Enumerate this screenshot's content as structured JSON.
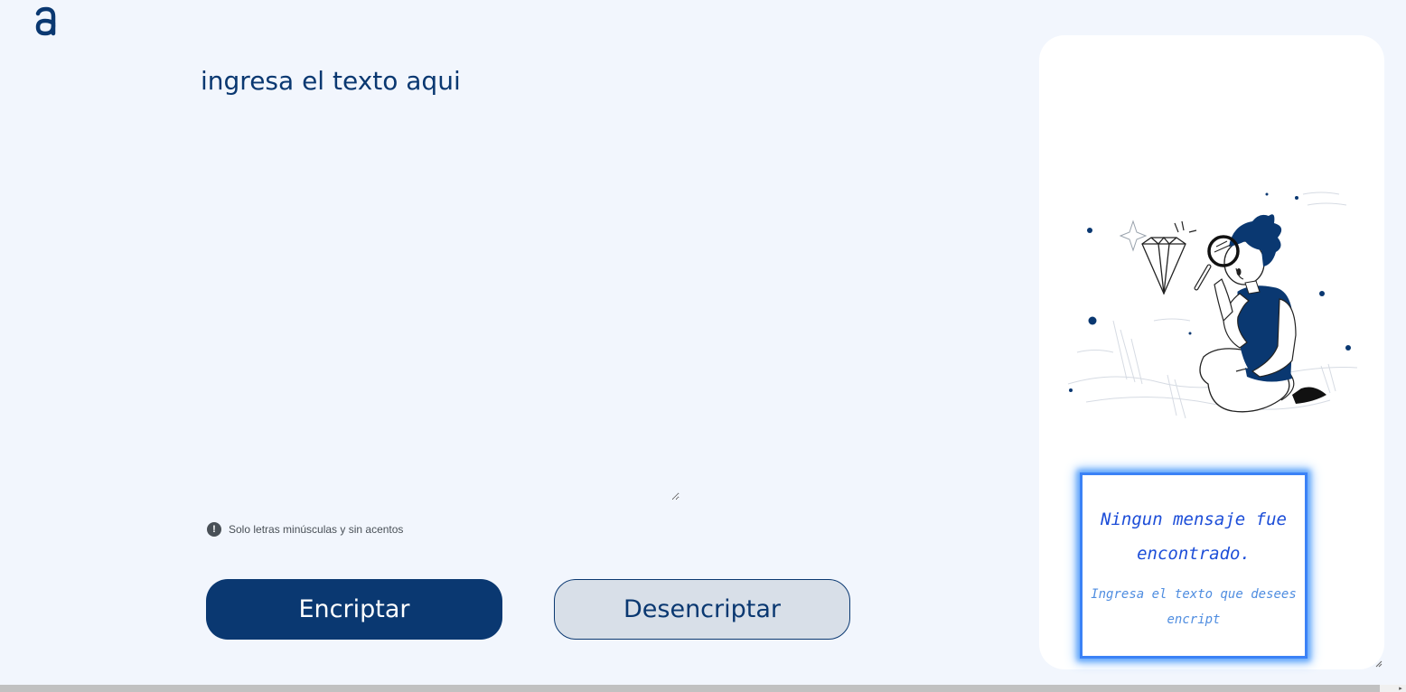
{
  "header": {
    "logo_icon": "alura-logo-icon"
  },
  "editor": {
    "placeholder": "ingresa el texto aqui",
    "value": ""
  },
  "hint": {
    "icon": "exclamation-circle-icon",
    "text": "Solo letras minúsculas y sin acentos"
  },
  "actions": {
    "encrypt_label": "Encriptar",
    "decrypt_label": "Desencriptar"
  },
  "output": {
    "illustration": "person-with-magnifying-glass-illustration",
    "title": "Ningun mensaje fue encontrado.",
    "subtitle": "Ingresa el texto que desees encript"
  },
  "colors": {
    "background": "#f2f6fd",
    "primary": "#0a3871",
    "secondary_button": "#d8dfe8",
    "panel": "#ffffff",
    "message_glow": "#3b82f6"
  }
}
